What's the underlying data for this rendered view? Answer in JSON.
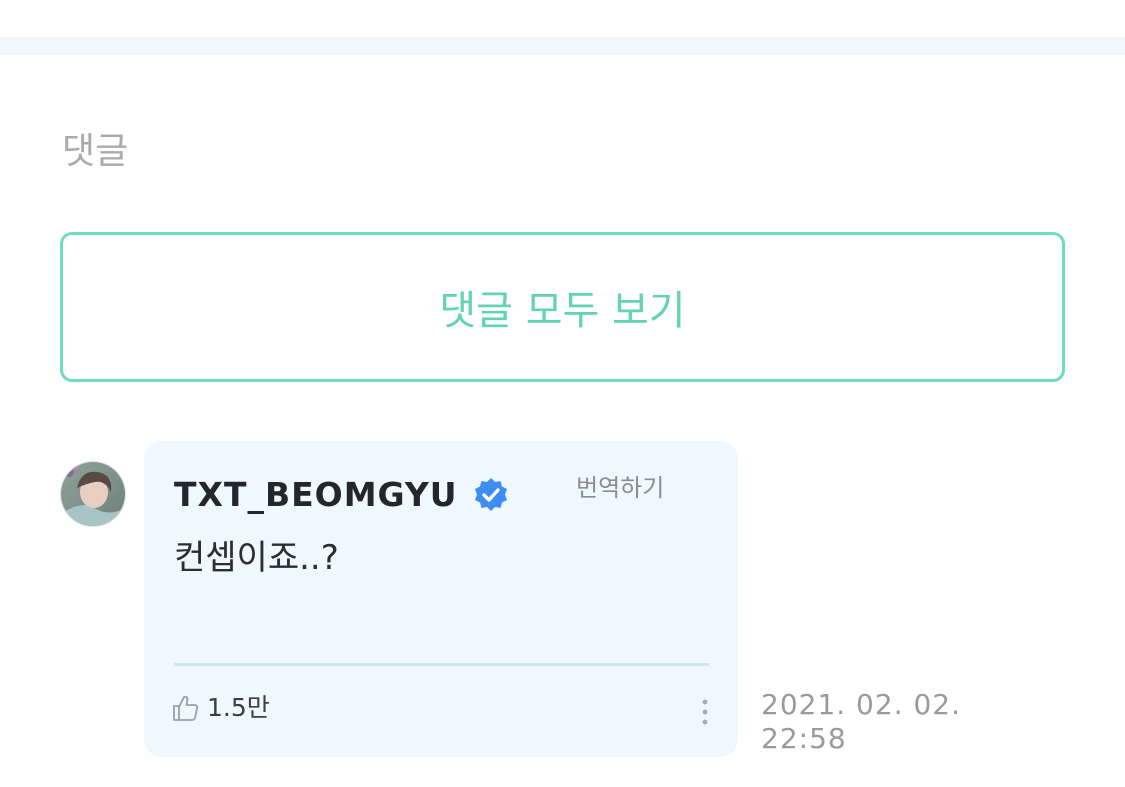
{
  "comments_section": {
    "title": "댓글",
    "view_all_label": "댓글 모두 보기"
  },
  "comment": {
    "author": "TXT_BEOMGYU",
    "verified_icon": "verified-badge-icon",
    "translate_label": "번역하기",
    "text": "컨셉이죠..?",
    "likes": "1.5만",
    "like_icon": "thumbs-up-icon",
    "more_icon": "more-vertical-icon",
    "date": "2021. 02. 02.",
    "time": "22:58"
  },
  "colors": {
    "accent": "#63d3b6",
    "bubble_bg": "#eff8fd",
    "verified": "#3d8ef0"
  }
}
